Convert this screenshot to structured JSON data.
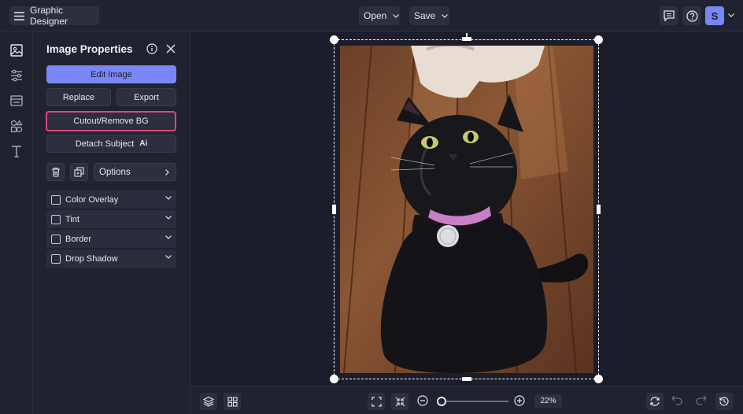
{
  "header": {
    "app_title": "Graphic Designer",
    "open_label": "Open",
    "save_label": "Save",
    "avatar_initial": "S"
  },
  "panel": {
    "title": "Image Properties",
    "edit_image_label": "Edit Image",
    "replace_label": "Replace",
    "export_label": "Export",
    "cutout_label": "Cutout/Remove BG",
    "detach_label": "Detach Subject",
    "detach_badge": "Ai",
    "options_label": "Options",
    "effects": [
      {
        "label": "Color Overlay"
      },
      {
        "label": "Tint"
      },
      {
        "label": "Border"
      },
      {
        "label": "Drop Shadow"
      }
    ]
  },
  "footer": {
    "zoom_text": "22%",
    "zoom_level": 0.05
  },
  "colors": {
    "accent": "#7a86f5",
    "highlight": "#e0467b",
    "background": "#1f2130"
  }
}
